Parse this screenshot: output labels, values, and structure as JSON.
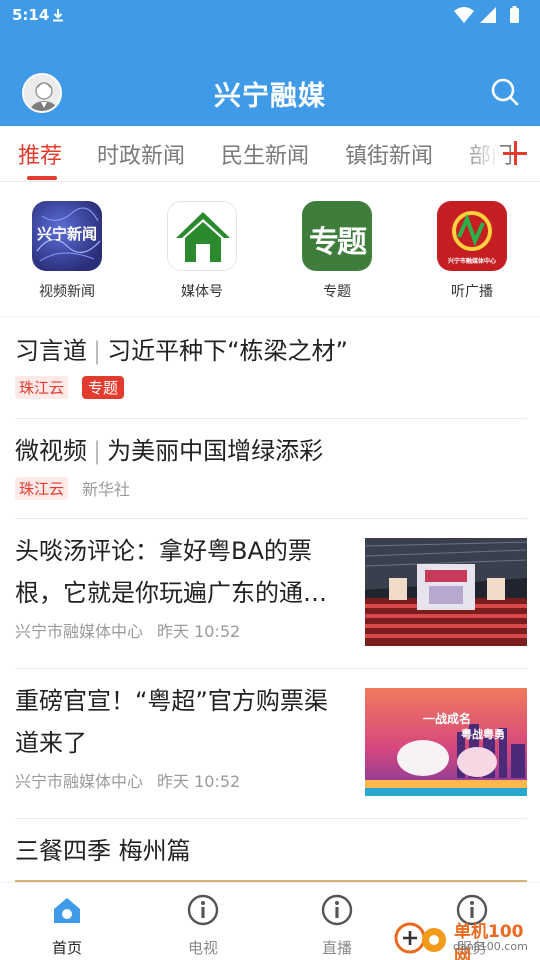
{
  "status_bar": {
    "time": "5:14"
  },
  "header": {
    "title": "兴宁融媒"
  },
  "tabs": [
    {
      "label": "推荐",
      "active": true
    },
    {
      "label": "时政新闻",
      "active": false
    },
    {
      "label": "民生新闻",
      "active": false
    },
    {
      "label": "镇街新闻",
      "active": false
    },
    {
      "label": "部门",
      "active": false
    }
  ],
  "quick_entries": [
    {
      "label": "视频新闻",
      "icon_text": "兴宁新闻",
      "icon": "video-news-icon"
    },
    {
      "label": "媒体号",
      "icon": "house-icon"
    },
    {
      "label": "专题",
      "icon_text": "专题",
      "icon": "topic-icon"
    },
    {
      "label": "听广播",
      "icon_text": "兴宁市融媒体中心",
      "icon": "radio-icon"
    }
  ],
  "feed": [
    {
      "title_a": "习言道",
      "title_b": "习近平种下“栋梁之材”",
      "source_tag": "珠江云",
      "topic_tag": "专题"
    },
    {
      "title_a": "微视频",
      "title_b": "为美丽中国增绿添彩",
      "source_tag": "珠江云",
      "publisher": "新华社"
    },
    {
      "title": "头啖汤评论：拿好粤BA的票根，它就是你玩遍广东的通…",
      "publisher": "兴宁市融媒体中心",
      "time": "昨天 10:52"
    },
    {
      "title": "重磅官宣！“粤超”官方购票渠道来了",
      "publisher": "兴宁市融媒体中心",
      "time": "昨天 10:52",
      "thumb_text_1": "一战成名",
      "thumb_text_2": "粤战粤勇"
    },
    {
      "title": "三餐四季 梅州篇"
    }
  ],
  "bottom_nav": [
    {
      "label": "首页",
      "active": true
    },
    {
      "label": "电视",
      "active": false
    },
    {
      "label": "直播",
      "active": false
    },
    {
      "label": "服务",
      "active": false
    }
  ],
  "watermark": {
    "text": "单机100网",
    "url": "danji100.com"
  },
  "colors": {
    "primary": "#3f9ae8",
    "accent": "#e33b2e"
  }
}
